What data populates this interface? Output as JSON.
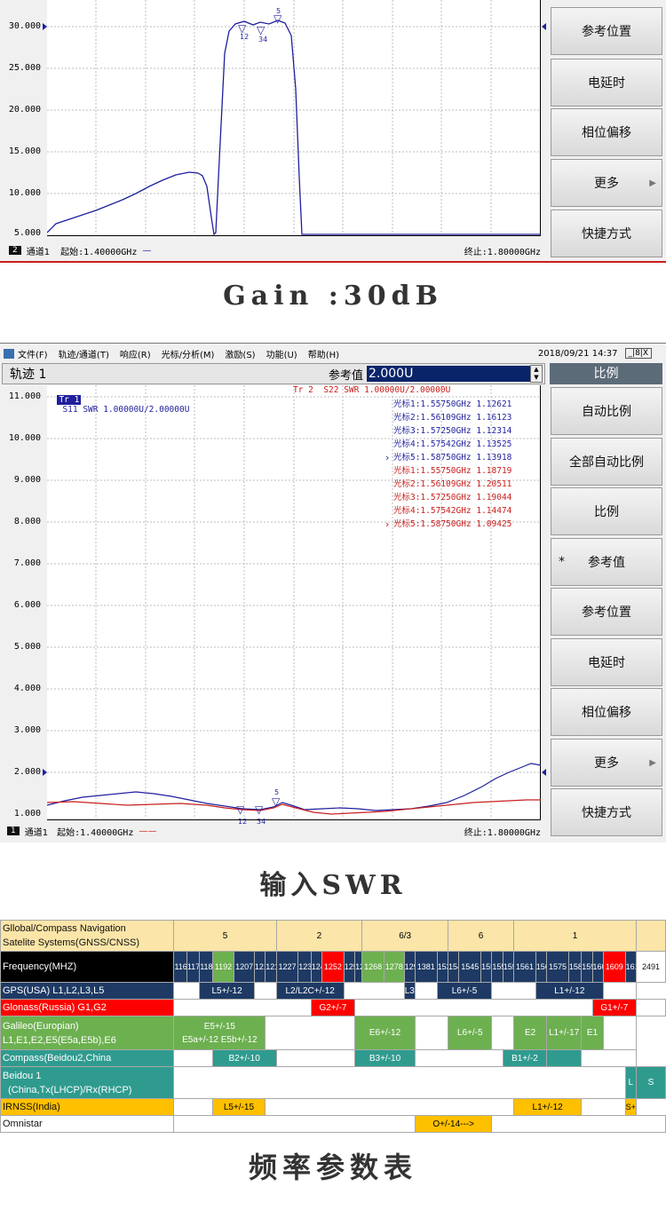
{
  "screen1": {
    "y_ticks": [
      "30.000",
      "25.000",
      "20.000",
      "15.000",
      "10.000",
      "5.000"
    ],
    "status_channel_num": "2",
    "status_channel": "通道1",
    "status_start": "起始:1.40000GHz",
    "status_stop": "终止:1.80000GHz",
    "marker_labels": [
      "12",
      "34",
      "5"
    ],
    "softkeys": [
      "参考位置",
      "电延时",
      "相位偏移",
      "更多",
      "快捷方式"
    ]
  },
  "caption1": "Gain :30dB",
  "screen2": {
    "menu": [
      "文件(F)",
      "轨迹/通道(T)",
      "响应(R)",
      "光标/分析(M)",
      "激励(S)",
      "功能(U)",
      "帮助(H)"
    ],
    "datetime": "2018/09/21 14:37",
    "window_controls": "_|8|X",
    "trace_title": "轨迹 1",
    "ref_label": "参考值",
    "ref_value": "2.000U",
    "panel_title": "比例",
    "tr1_tag": "Tr 1",
    "tr1_desc": "S11 SWR 1.00000U/2.00000U",
    "tr2_desc": "Tr 2  S22 SWR 1.00000U/2.00000U",
    "y_ticks": [
      "11.000",
      "10.000",
      "9.000",
      "8.000",
      "7.000",
      "6.000",
      "5.000",
      "4.000",
      "3.000",
      "2.000",
      "1.000"
    ],
    "marker_table_blue": [
      "光标1:1.55750GHz 1.12621",
      "光标2:1.56109GHz 1.16123",
      "光标3:1.57250GHz 1.12314",
      "光标4:1.57542GHz 1.13525",
      "光标5:1.58750GHz 1.13918"
    ],
    "marker_table_red": [
      "光标1:1.55750GHz 1.18719",
      "光标2:1.56109GHz 1.20511",
      "光标3:1.57250GHz 1.19044",
      "光标4:1.57542GHz 1.14474",
      "光标5:1.58750GHz 1.09425"
    ],
    "status_channel_num": "1",
    "status_channel": "通道1",
    "status_start": "起始:1.40000GHz",
    "status_stop": "终止:1.80000GHz",
    "marker_labels": [
      "12",
      "34",
      "5"
    ],
    "softkeys": [
      "自动比例",
      "全部自动比例",
      "比例",
      "参考值",
      "参考位置",
      "电延时",
      "相位偏移",
      "更多",
      "快捷方式"
    ]
  },
  "caption2": "输入SWR",
  "freq_table": {
    "title_line1": "Gllobal/Compass Navigation",
    "title_line2": "Satelite Systems(GNSS/CNSS)",
    "groups": [
      "5",
      "2",
      "6/3",
      "6",
      "1"
    ],
    "freq_header": "Frequency(MHZ)",
    "freqs": [
      "1164",
      "1176",
      "1188",
      "1192",
      "1207",
      "1215",
      "1219",
      "1227",
      "1239",
      "1245",
      "1252",
      "1258",
      "1260",
      "1268",
      "1278",
      "1290",
      "1381",
      "1535",
      "1540",
      "1545",
      "1550",
      "1558",
      "1559",
      "1561",
      "1563",
      "1575",
      "1587",
      "1592",
      "1602",
      "1609",
      "1616",
      "2491"
    ],
    "rows": [
      {
        "name": "GPS(USA) L1,L2,L3,L5",
        "cells": [
          "L5+/-12",
          "L2/L2C+/-12",
          "L3",
          "L6+/-5",
          "L1+/-12"
        ]
      },
      {
        "name": "Glonass(Russia)  G1,G2",
        "cells": [
          "G2+/-7",
          "G1+/-7"
        ]
      },
      {
        "name1": "Galileo(Europian)",
        "name2": "L1,E1,E2,E5(E5a,E5b),E6",
        "cells": [
          "E5+/-15",
          "E5a+/-12  E5b+/-12",
          "E6+/-12",
          "L6+/-5",
          "E2",
          "L1+/-17",
          "E1"
        ]
      },
      {
        "name": "Compass(Beidou2,China",
        "cells": [
          "B2+/-10",
          "B3+/-10",
          "B1+/-2"
        ]
      },
      {
        "name1": "Beidou 1",
        "name2": "(China,Tx(LHCP)/Rx(RHCP)",
        "cells": [
          "L",
          "S"
        ]
      },
      {
        "name": "IRNSS(India)",
        "cells": [
          "L5+/-15",
          "L1+/-12",
          "S+/-15"
        ]
      },
      {
        "name": "Omnistar",
        "cells": [
          "O+/-14--->"
        ]
      }
    ]
  },
  "caption3": "频率参数表",
  "colors": {
    "trace_blue": "#1f1f9e",
    "trace_red": "#c8201e",
    "navy_header": "#1e3a64",
    "green": "#6db050",
    "teal": "#2f9b8f",
    "yellow": "#ffc000",
    "red": "#ff0000"
  }
}
